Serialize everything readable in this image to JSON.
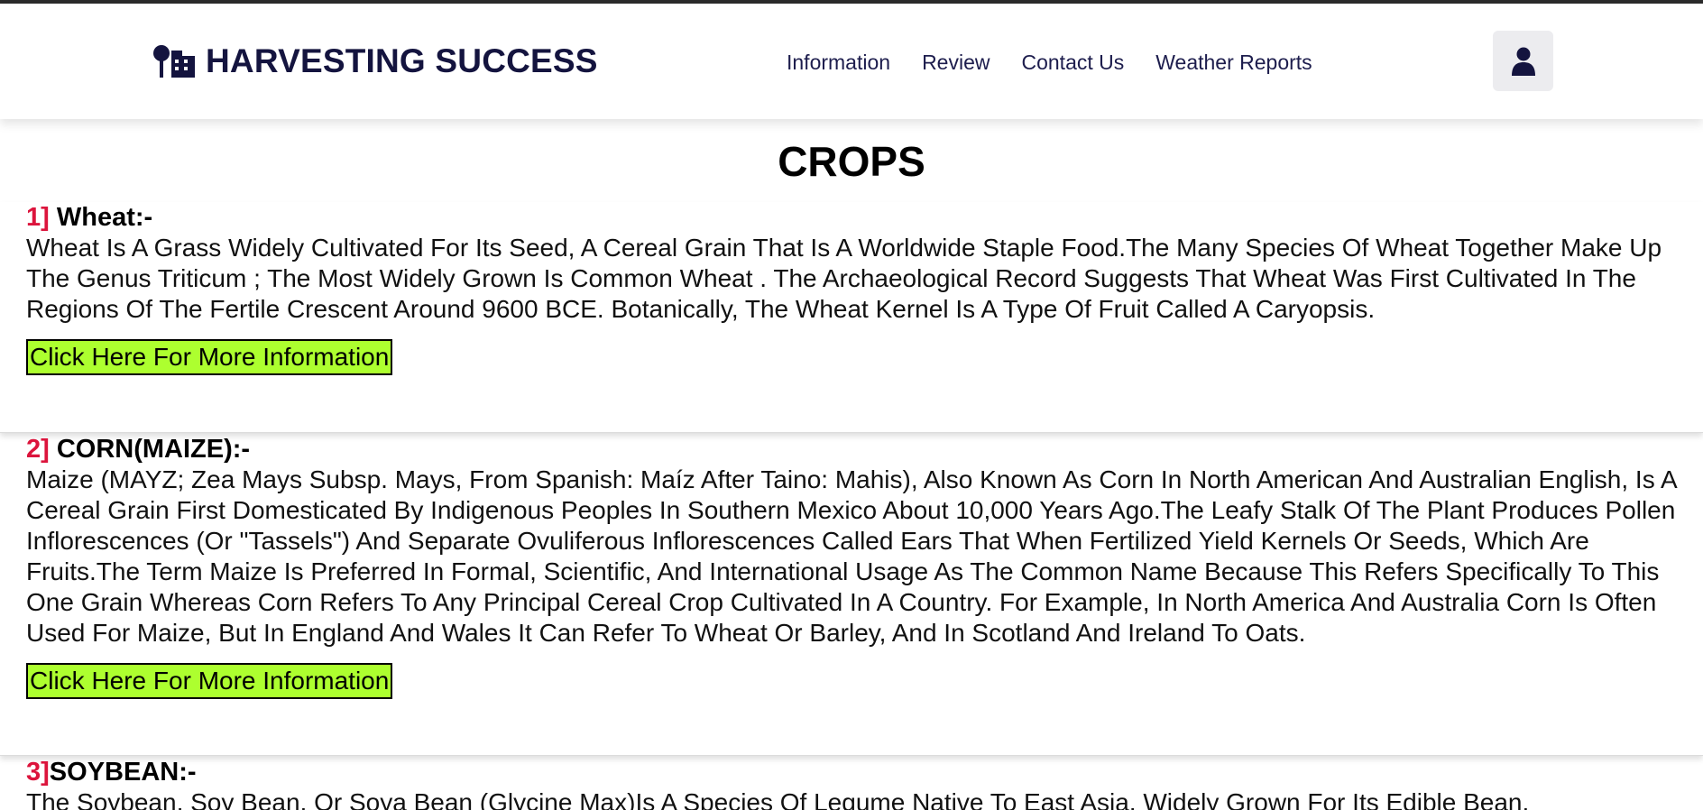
{
  "header": {
    "brand": "HARVESTING SUCCESS",
    "nav": [
      "Information",
      "Review",
      "Contact Us",
      "Weather Reports"
    ],
    "user_icon": "user-icon",
    "brand_icon": "tree-building-icon"
  },
  "page": {
    "title": "CROPS"
  },
  "crops": [
    {
      "num": "1]",
      "name": "Wheat:-",
      "description": "Wheat Is A Grass Widely Cultivated For Its Seed, A Cereal Grain That Is A Worldwide Staple Food.The Many Species Of Wheat Together Make Up The Genus Triticum ; The Most Widely Grown Is Common Wheat . The Archaeological Record Suggests That Wheat Was First Cultivated In The Regions Of The Fertile Crescent Around 9600 BCE. Botanically, The Wheat Kernel Is A Type Of Fruit Called A Caryopsis.",
      "button": "Click Here For More Information"
    },
    {
      "num": "2]",
      "name": "CORN(MAIZE):-",
      "description": "Maize (MAYZ; Zea Mays Subsp. Mays, From Spanish: Maíz After Taino: Mahis), Also Known As Corn In North American And Australian English, Is A Cereal Grain First Domesticated By Indigenous Peoples In Southern Mexico About 10,000 Years Ago.The Leafy Stalk Of The Plant Produces Pollen Inflorescences (Or \"Tassels\") And Separate Ovuliferous Inflorescences Called Ears That When Fertilized Yield Kernels Or Seeds, Which Are Fruits.The Term Maize Is Preferred In Formal, Scientific, And International Usage As The Common Name Because This Refers Specifically To This One Grain Whereas Corn Refers To Any Principal Cereal Crop Cultivated In A Country. For Example, In North America And Australia Corn Is Often Used For Maize, But In England And Wales It Can Refer To Wheat Or Barley, And In Scotland And Ireland To Oats.",
      "button": "Click Here For More Information"
    },
    {
      "num": "3]",
      "name": "SOYBEAN:-",
      "description": "The Soybean, Soy Bean, Or Soya Bean (Glycine Max)Is A Species Of Legume Native To East Asia, Widely Grown For Its Edible Bean."
    }
  ],
  "colors": {
    "accent_button": "#adff2f",
    "number": "#dc143c",
    "brand": "#14143f"
  }
}
